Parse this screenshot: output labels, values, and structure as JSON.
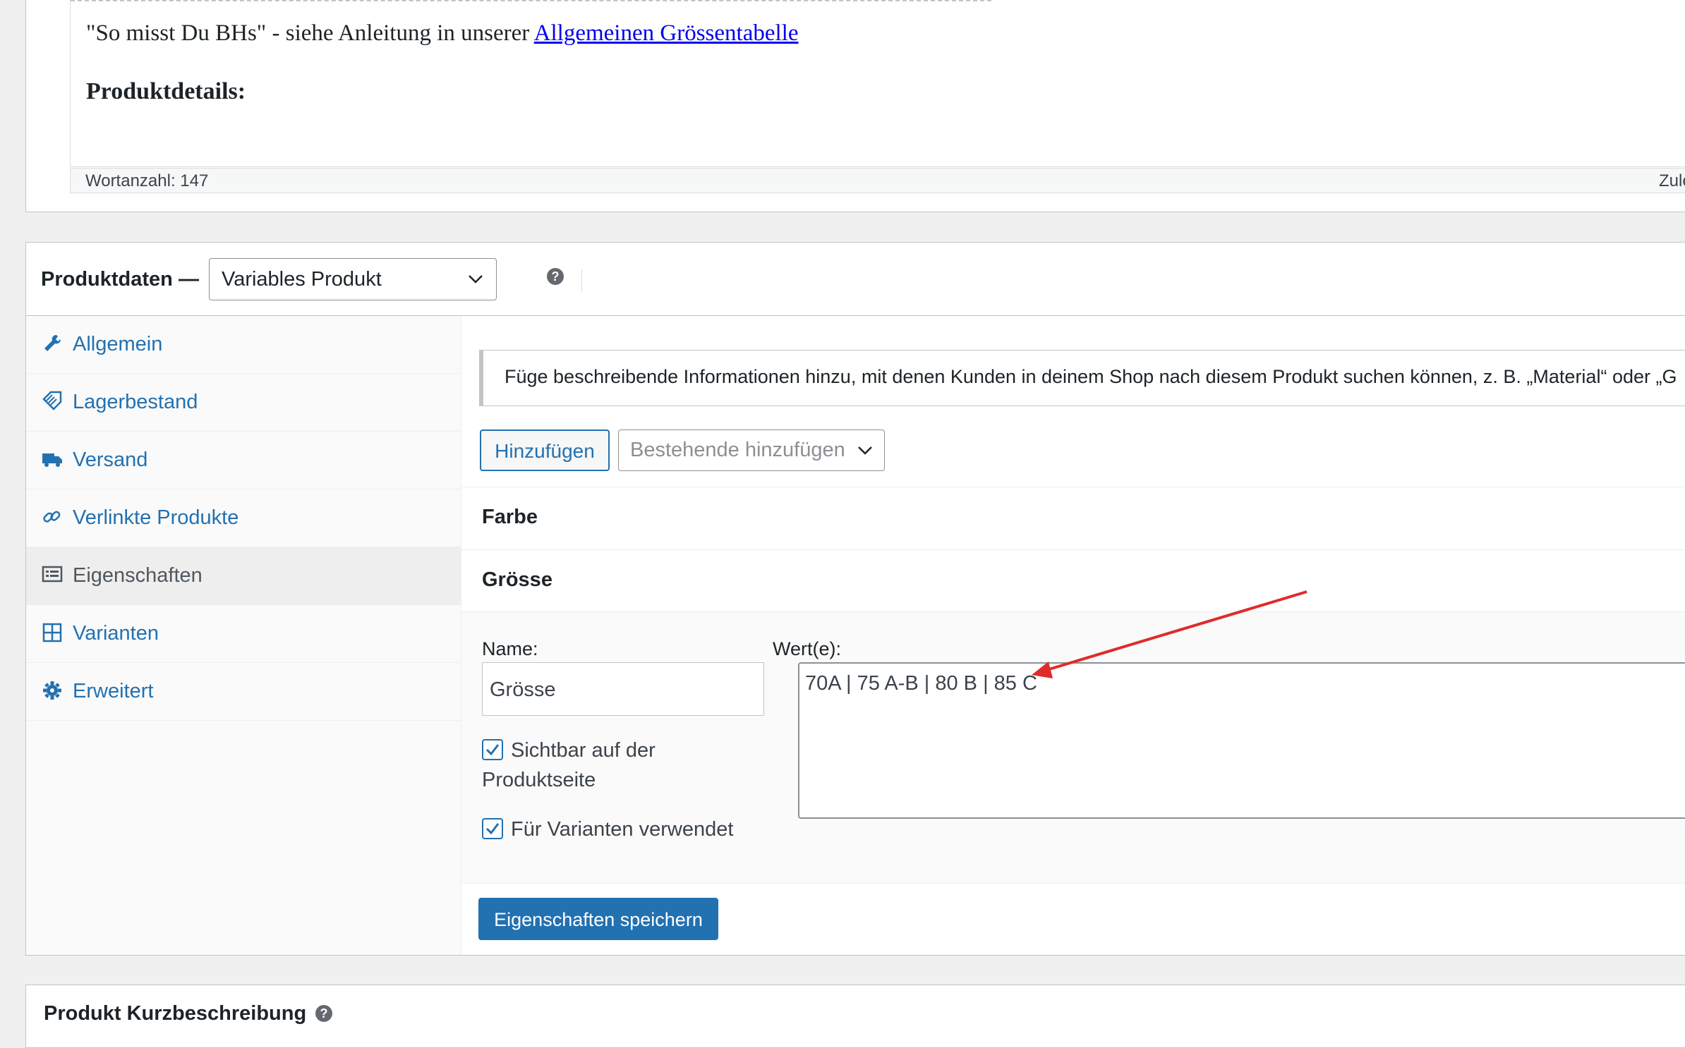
{
  "editor": {
    "line_prefix": "\"So misst Du BHs\" - siehe Anleitung in unserer ",
    "line_link": "Allgemeinen Grössentabelle",
    "heading": "Produktdetails:",
    "word_count": "Wortanzahl: 147",
    "last_modified": "Zuletz"
  },
  "product_data": {
    "title": "Produktdaten —",
    "type_select": "Variables Produkt",
    "tabs": [
      {
        "label": "Allgemein",
        "icon": "wrench-icon"
      },
      {
        "label": "Lagerbestand",
        "icon": "tag-icon"
      },
      {
        "label": "Versand",
        "icon": "truck-icon"
      },
      {
        "label": "Verlinkte Produkte",
        "icon": "link-icon"
      },
      {
        "label": "Eigenschaften",
        "icon": "list-icon",
        "active": true
      },
      {
        "label": "Varianten",
        "icon": "grid-icon"
      },
      {
        "label": "Erweitert",
        "icon": "gear-icon"
      }
    ]
  },
  "attributes": {
    "notice": "Füge beschreibende Informationen hinzu, mit denen Kunden in deinem Shop nach diesem Produkt suchen können, z. B. „Material“ oder „G",
    "add_button": "Hinzufügen",
    "existing_select": "Bestehende hinzufügen",
    "rows": [
      "Farbe",
      "Grösse"
    ],
    "edit": {
      "name_label": "Name:",
      "name_value": "Grösse",
      "values_label": "Wert(e):",
      "values_value": "70A | 75 A-B | 80 B | 85 C",
      "visible_label_1": "Sichtbar auf der",
      "visible_label_2": "Produktseite",
      "visible_checked": true,
      "variations_label": "Für Varianten verwendet",
      "variations_checked": true
    },
    "save_button": "Eigenschaften speichern"
  },
  "short_description": {
    "title": "Produkt Kurzbeschreibung"
  },
  "colors": {
    "link": "#2271b1",
    "primary_button": "#2271b1",
    "annotation_arrow": "#e02b2b"
  }
}
